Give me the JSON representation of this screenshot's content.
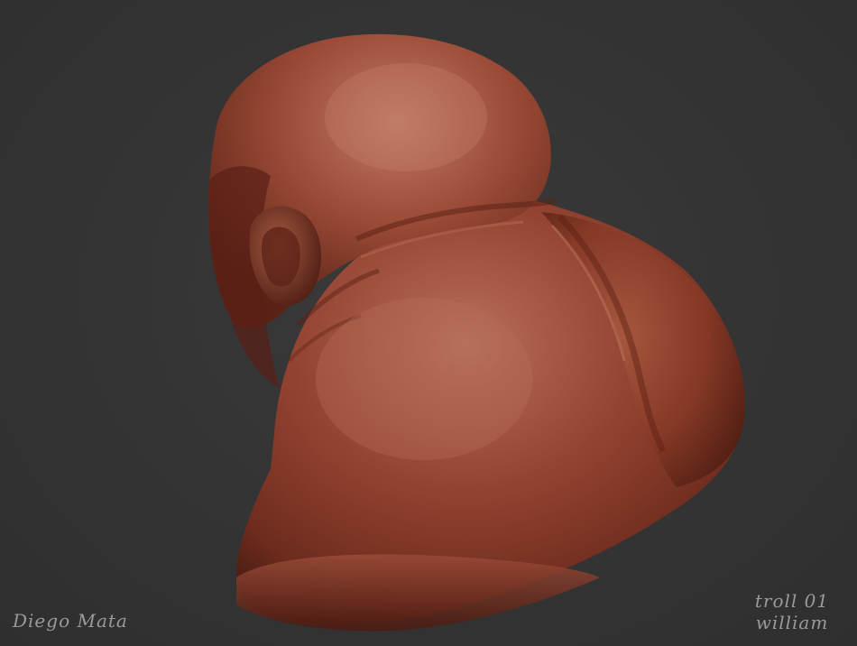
{
  "image": {
    "subject": "sculpt-bust",
    "background_color": "#343434",
    "material_color": "#8a3d29",
    "highlight_color": "#b56a4e",
    "shadow_color": "#3a1610"
  },
  "watermarks": {
    "artist": "Diego Mata",
    "title_line1": "troll 01",
    "title_line2": "william"
  }
}
